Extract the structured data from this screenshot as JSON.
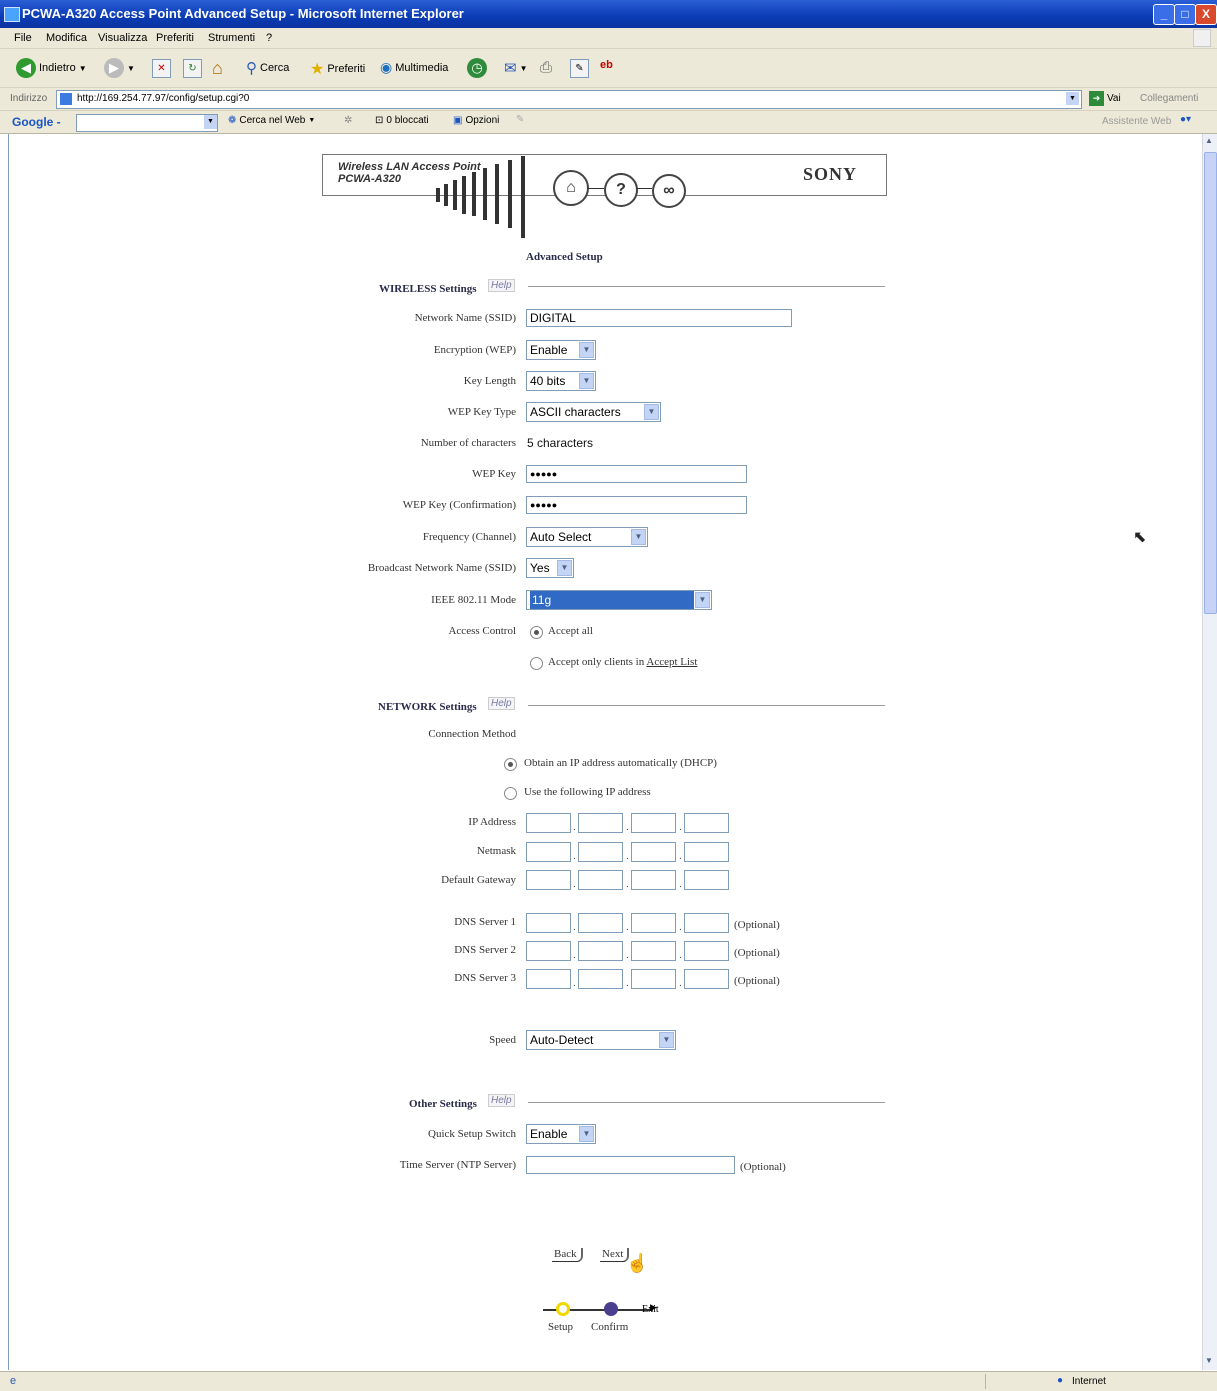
{
  "window": {
    "title": "PCWA-A320 Access Point Advanced Setup - Microsoft Internet Explorer",
    "controls": [
      "_",
      "□",
      "X"
    ]
  },
  "menubar": [
    "File",
    "Modifica",
    "Visualizza",
    "Preferiti",
    "Strumenti",
    "?"
  ],
  "toolbar": {
    "back": "Indietro",
    "search": "Cerca",
    "favorites": "Preferiti",
    "multimedia": "Multimedia"
  },
  "addressbar": {
    "label": "Indirizzo",
    "url": "http://169.254.77.97/config/setup.cgi?0",
    "go": "Vai",
    "links": "Collegamenti"
  },
  "googlebar": {
    "logo": "Google -",
    "search_web": "Cerca nel Web",
    "blocked": "0 bloccati",
    "options": "Opzioni",
    "assistant": "Assistente Web"
  },
  "header": {
    "product_line1": "Wireless LAN Access Point",
    "product_line2": "PCWA-A320",
    "brand": "SONY",
    "home_icon": "⌂",
    "help_icon": "?",
    "link_icon": "∞"
  },
  "page": {
    "title": "Advanced Setup",
    "help_label": "Help"
  },
  "wireless": {
    "section_title": "WIRELESS Settings",
    "network_name_label": "Network Name (SSID)",
    "network_name_value": "DIGITAL",
    "encryption_label": "Encryption (WEP)",
    "encryption_value": "Enable",
    "key_length_label": "Key Length",
    "key_length_value": "40 bits",
    "wep_key_type_label": "WEP Key Type",
    "wep_key_type_value": "ASCII characters",
    "num_chars_label": "Number of characters",
    "num_chars_value": "5 characters",
    "wep_key_label": "WEP Key",
    "wep_key_value": "●●●●●",
    "wep_key_confirm_label": "WEP Key (Confirmation)",
    "wep_key_confirm_value": "●●●●●",
    "frequency_label": "Frequency (Channel)",
    "frequency_value": "Auto Select",
    "broadcast_label": "Broadcast Network Name (SSID)",
    "broadcast_value": "Yes",
    "ieee_label": "IEEE 802.11 Mode",
    "ieee_value": "11g",
    "access_control_label": "Access Control",
    "accept_all": "Accept all",
    "accept_only": "Accept only clients in ",
    "accept_list_link": "Accept List"
  },
  "network": {
    "section_title": "NETWORK Settings",
    "connection_method_label": "Connection Method",
    "dhcp_option": "Obtain an IP address automatically (DHCP)",
    "static_option": "Use the following IP address",
    "ip_label": "IP Address",
    "netmask_label": "Netmask",
    "gateway_label": "Default Gateway",
    "dns1_label": "DNS Server 1",
    "dns2_label": "DNS Server 2",
    "dns3_label": "DNS Server 3",
    "optional": "(Optional)",
    "speed_label": "Speed",
    "speed_value": "Auto-Detect"
  },
  "other": {
    "section_title": "Other Settings",
    "quick_setup_label": "Quick Setup Switch",
    "quick_setup_value": "Enable",
    "time_server_label": "Time Server (NTP Server)",
    "optional": "(Optional)"
  },
  "nav": {
    "back": "Back",
    "next": "Next",
    "exit": "Exit",
    "step_setup": "Setup",
    "step_confirm": "Confirm"
  },
  "statusbar": {
    "zone": "Internet"
  },
  "colors": {
    "titlebar": "#0b3bb4",
    "chrome": "#ece9d8",
    "step_setup": "#f2d700",
    "step_confirm": "#4a3f8f",
    "selection": "#316ac5"
  }
}
